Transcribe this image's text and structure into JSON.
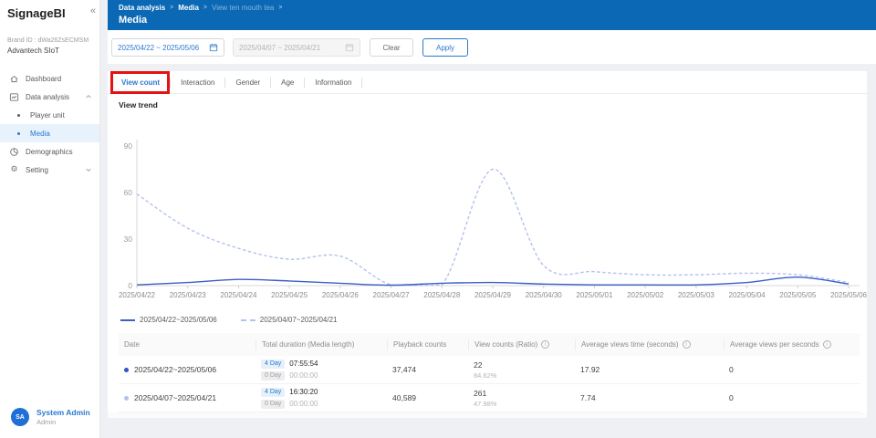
{
  "colors": {
    "header_blue": "#0a68b4",
    "accent_blue": "#2979cf",
    "annotation_red": "#e31313",
    "series_solid": "#3a5fc8",
    "series_dashed": "#b3c1ee",
    "active_nav_bg": "#e7f2fd"
  },
  "sidebar": {
    "logo": "SignageBI",
    "collapse_icon": "«",
    "brand_id": "Brand ID : dWa26ZsECMSM",
    "brand_name": "Advantech SIoT",
    "items": [
      {
        "label": "Dashboard"
      },
      {
        "label": "Data analysis"
      },
      {
        "label": "Player unit"
      },
      {
        "label": "Media"
      },
      {
        "label": "Demographics"
      },
      {
        "label": "Setting"
      }
    ],
    "user": {
      "initials": "SA",
      "name": "System Admin",
      "role": "Admin"
    }
  },
  "header": {
    "breadcrumb": [
      "Data analysis",
      "Media",
      "View ten mouth tea"
    ],
    "separator": ">",
    "title": "Media"
  },
  "filters": {
    "date_range_primary": "2025/04/22 ~ 2025/05/06",
    "date_range_compare": "2025/04/07 ~ 2025/04/21",
    "clear_label": "Clear",
    "apply_label": "Apply"
  },
  "tabs": {
    "items": [
      "View count",
      "Interaction",
      "Gender",
      "Age",
      "Information"
    ],
    "active": "View count"
  },
  "section": {
    "chart_title": "View trend"
  },
  "chart_data": {
    "type": "line",
    "title": "View trend",
    "x": [
      "2025/04/22",
      "2025/04/23",
      "2025/04/24",
      "2025/04/25",
      "2025/04/26",
      "2025/04/27",
      "2025/04/28",
      "2025/04/29",
      "2025/04/30",
      "2025/05/01",
      "2025/05/02",
      "2025/05/03",
      "2025/05/04",
      "2025/05/05",
      "2025/05/06"
    ],
    "series": [
      {
        "name": "2025/04/22~2025/05/06",
        "style": "solid",
        "color": "#3a5fc8",
        "values": [
          0.5,
          2,
          4,
          3,
          1.5,
          0.3,
          1.5,
          2,
          1,
          0.5,
          0.5,
          0.5,
          2,
          5.5,
          1
        ]
      },
      {
        "name": "2025/04/07~2025/04/21",
        "style": "dashed",
        "color": "#b3c1ee",
        "values": [
          59,
          37,
          24,
          17,
          19,
          0.5,
          0.5,
          75,
          13,
          9,
          7,
          7,
          8,
          7,
          2
        ]
      }
    ],
    "ylim": [
      0,
      90
    ],
    "yticks": [
      0,
      30,
      60,
      90
    ],
    "grid": false,
    "legend_position": "bottom-left"
  },
  "table": {
    "columns": [
      {
        "label": "Date",
        "info": false
      },
      {
        "label": "Total duration (Media length)",
        "info": false
      },
      {
        "label": "Playback counts",
        "info": false
      },
      {
        "label": "View counts (Ratio)",
        "info": true
      },
      {
        "label": "Average views time (seconds)",
        "info": true
      },
      {
        "label": "Average views per seconds",
        "info": true
      }
    ],
    "rows": [
      {
        "date": "2025/04/22~2025/05/06",
        "duration_primary_badge": "4 Day",
        "duration_primary": "07:55:54",
        "duration_secondary_badge": "0 Day",
        "duration_secondary": "00:00:00",
        "playback": "37,474",
        "views": "22",
        "ratio": "84.62%",
        "avg_time": "17.92",
        "avg_per_second": "0"
      },
      {
        "date": "2025/04/07~2025/04/21",
        "duration_primary_badge": "4 Day",
        "duration_primary": "16:30:20",
        "duration_secondary_badge": "0 Day",
        "duration_secondary": "00:00:00",
        "playback": "40,589",
        "views": "261",
        "ratio": "47.98%",
        "avg_time": "7.74",
        "avg_per_second": "0"
      }
    ]
  }
}
